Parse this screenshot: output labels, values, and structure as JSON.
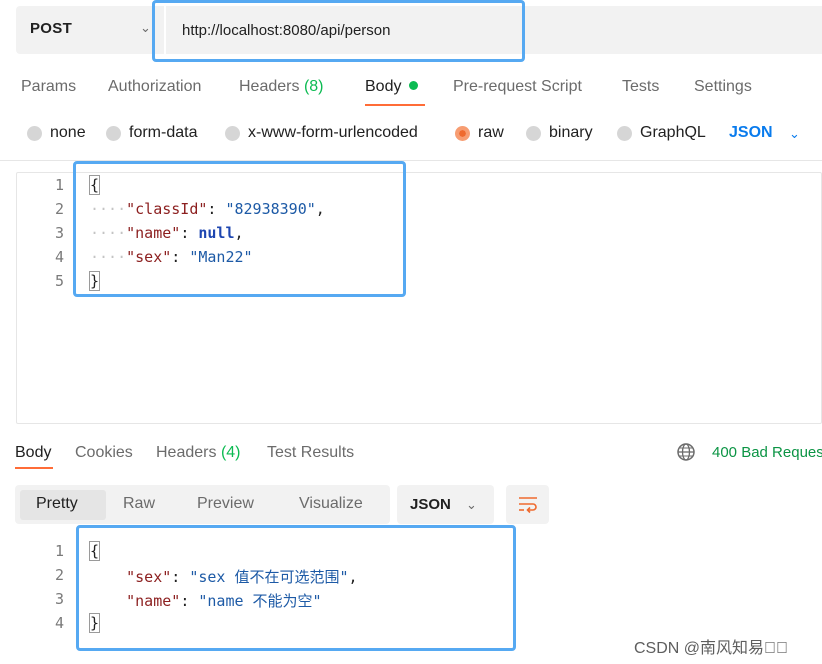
{
  "request": {
    "method": "POST",
    "url": "http://localhost:8080/api/person"
  },
  "request_tabs": {
    "params": "Params",
    "authorization": "Authorization",
    "headers_label": "Headers",
    "headers_count": "(8)",
    "body": "Body",
    "pre_request_script": "Pre-request Script",
    "tests": "Tests",
    "settings": "Settings"
  },
  "body_types": {
    "none": "none",
    "form_data": "form-data",
    "urlencoded": "x-www-form-urlencoded",
    "raw": "raw",
    "binary": "binary",
    "graphql": "GraphQL",
    "selected": "raw",
    "format": "JSON"
  },
  "request_body": {
    "line_numbers": [
      "1",
      "2",
      "3",
      "4",
      "5"
    ],
    "open_brace": "{",
    "close_brace": "}",
    "fields": [
      {
        "key": "\"classId\"",
        "value": "\"82938390\"",
        "trail": ","
      },
      {
        "key": "\"name\"",
        "value": "null",
        "trail": ","
      },
      {
        "key": "\"sex\"",
        "value": "\"Man22\"",
        "trail": ""
      }
    ]
  },
  "response_tabs": {
    "body": "Body",
    "cookies": "Cookies",
    "headers_label": "Headers",
    "headers_count": "(4)",
    "test_results": "Test Results"
  },
  "status": {
    "text": "400 Bad Reques",
    "color": "#0b9444"
  },
  "response_view": {
    "pretty": "Pretty",
    "raw": "Raw",
    "preview": "Preview",
    "visualize": "Visualize",
    "format": "JSON"
  },
  "response_body": {
    "line_numbers": [
      "1",
      "2",
      "3",
      "4"
    ],
    "open_brace": "{",
    "close_brace": "}",
    "fields": [
      {
        "key": "\"sex\"",
        "value": "\"sex 值不在可选范围\"",
        "trail": ","
      },
      {
        "key": "\"name\"",
        "value": "\"name 不能为空\"",
        "trail": ""
      }
    ]
  },
  "watermark": "CSDN @南风知易\u0000\u0000",
  "colors": {
    "accent_orange": "#ff6c37",
    "link_blue": "#097bed",
    "highlight_box": "#56a9f2"
  },
  "icons": [
    "chevron-down-icon",
    "radio-icon",
    "globe-icon",
    "wrap-lines-icon"
  ]
}
